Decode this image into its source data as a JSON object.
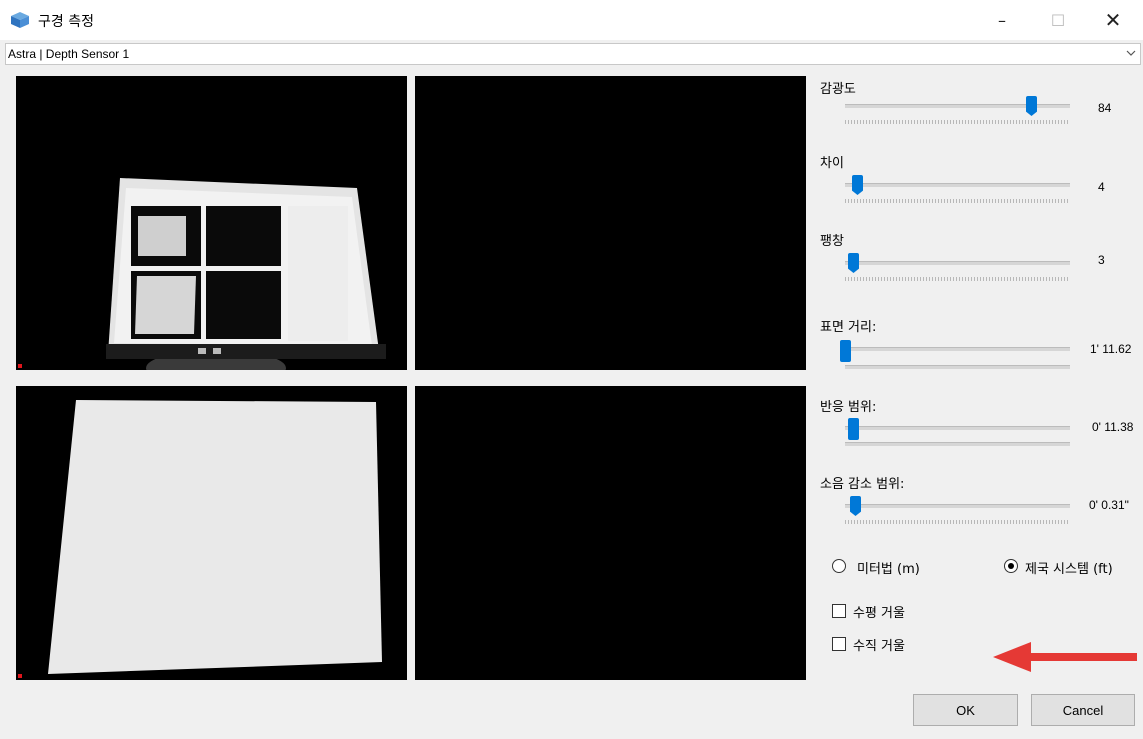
{
  "window": {
    "title": "구경 측정",
    "minimize": "–",
    "maximize": "☐",
    "close": "✕"
  },
  "device": {
    "selected": "Astra | Depth Sensor 1"
  },
  "sliders": [
    {
      "label": "감광도",
      "value": "84",
      "level": 0.85
    },
    {
      "label": "차이",
      "value": "4",
      "level": 0.05
    },
    {
      "label": "팽창",
      "value": "3",
      "level": 0.04
    },
    {
      "label": "표면 거리:",
      "value": "1' 11.62",
      "level": 0.03
    },
    {
      "label": "반응 범위:",
      "value": "0' 11.38",
      "level": 0.05
    },
    {
      "label": "소음 감소 범위:",
      "value": "0' 0.31\"",
      "level": 0.06
    }
  ],
  "units": {
    "metric": "미터법 (m)",
    "imperial": "제국 시스템 (ft)",
    "selected": "imperial"
  },
  "mirror": {
    "horizontal": "수평 거울",
    "vertical": "수직 거울",
    "horizontal_checked": false,
    "vertical_checked": false
  },
  "buttons": {
    "ok": "OK",
    "cancel": "Cancel"
  },
  "colors": {
    "accent": "#0078d7",
    "annotation_arrow": "#e53935",
    "preview_bg": "#000000"
  }
}
